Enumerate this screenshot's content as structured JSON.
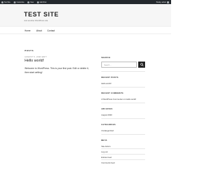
{
  "adminbar": {
    "items": [
      "Test Site",
      "Customize",
      "New",
      "Edit Post"
    ],
    "right": "Howdy, admin"
  },
  "header": {
    "site_title": "TEST SITE",
    "tagline": "Just another WordPress site"
  },
  "nav": {
    "items": [
      "Home",
      "About",
      "Contact"
    ]
  },
  "main": {
    "section_title": "POSTS",
    "post": {
      "meta": "AUGUST 5, 2020  EDIT",
      "title": "Hello world!",
      "content": "Welcome to WordPress. This is your first post. Edit or delete it, then start writing!"
    }
  },
  "sidebar": {
    "search_title": "SEARCH",
    "search_placeholder": "Search ...",
    "recent_posts_title": "RECENT POSTS",
    "recent_posts": [
      "Hello world!"
    ],
    "recent_comments_title": "RECENT COMMENTS",
    "recent_comments": [
      "A WordPress Commenter on Hello world!"
    ],
    "archives_title": "ARCHIVES",
    "archives": [
      "August 2020"
    ],
    "categories_title": "CATEGORIES",
    "categories": [
      "Uncategorized"
    ],
    "meta_title": "META",
    "meta_links": [
      "Site Admin",
      "Log out",
      "Entries feed",
      "Comments feed"
    ]
  }
}
